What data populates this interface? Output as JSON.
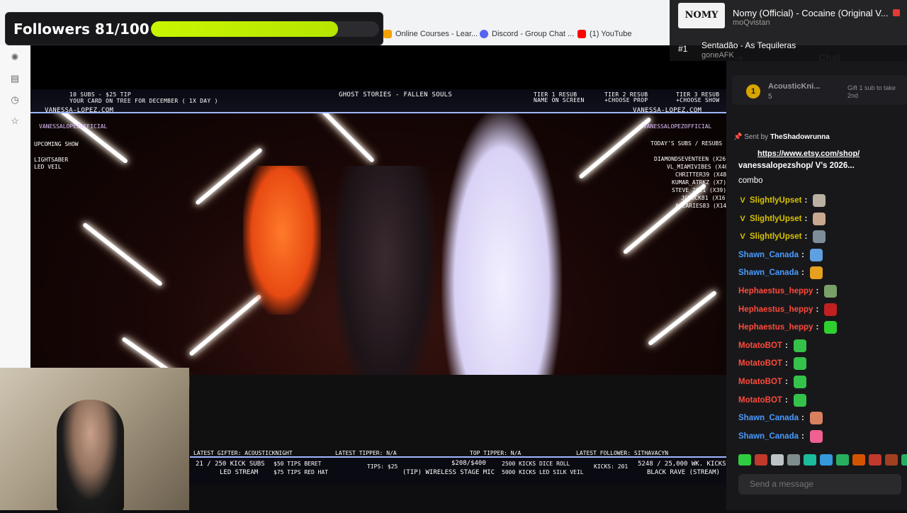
{
  "browser": {
    "bookmarks": [
      {
        "label": "Online Courses - Lear...",
        "icon": "courses-icon",
        "color": "#f2a100"
      },
      {
        "label": "Discord - Group Chat ...",
        "icon": "discord-icon",
        "color": "#5865f2"
      },
      {
        "label": "(1) YouTube",
        "icon": "youtube-icon",
        "color": "#ff0000"
      }
    ]
  },
  "followers_widget": {
    "label": "Followers 81/100",
    "progress": 0.82,
    "bar_color": "#c8f500"
  },
  "now_playing": {
    "art_text": "NOMY",
    "title": "Nomy (Official) - Cocaine (Original V...",
    "artist": "moQvistan",
    "next_rank": "#1",
    "next_title": "Sentadão - As Tequileras",
    "next_artist": "goneAFK"
  },
  "stream_overlay": {
    "top_left_1": "10 SUBS - $25 TIP",
    "top_left_2": "YOUR CARD ON TREE FOR DECEMBER ( 1X DAY )",
    "site_left": "VANESSA-LOPEZ.COM",
    "handle_left": "VANESSALOPEZOFFICIAL",
    "title_center": "GHOST STORIES - FALLEN SOULS",
    "tier1": "TIER 1 RESUB",
    "tier1_sub": "NAME ON SCREEN",
    "tier2": "TIER 2 RESUB",
    "tier2_sub": "+CHOOSE PROP",
    "tier3": "TIER 3 RESUB",
    "tier3_sub": "+CHOOSE SHOW",
    "site_right": "VANESSA-LOPEZ.COM",
    "handle_right": "VANESSALOPEZOFFICIAL",
    "upcoming": "UPCOMING SHOW",
    "upcoming_items": [
      "LIGHTSABER",
      "LED VEIL"
    ],
    "todays": "TODAY'S SUBS / RESUBS",
    "sub_list": [
      "DIAMONDSEVENTEEN (X26)",
      "VL_MIAMIVIBES (X40)",
      "CHRITTER39 (X48)",
      "KUMAR_ATRKZ (X7)",
      "STEVE_2021 (X39)",
      "JCROCK81 (X16)",
      "ACEARIES83 (X14)"
    ],
    "latest_gifter": "LATEST GIFTER: ACOUSTICKNIGHT",
    "latest_tipper": "LATEST TIPPER: N/A",
    "top_tipper": "TOP TIPPER: N/A",
    "latest_follower": "LATEST FOLLOWER: SITHAVACYN",
    "kick_subs": "21 / 250 KICK SUBS",
    "led_stream": "LED STREAM",
    "tips1": "$50  TIPS  BERET",
    "tips2": "$75  TIPS  RED HAT",
    "tips_total": "TIPS: $25",
    "goal": "$208/$400",
    "goal_item": "(TIP) WIRELESS STAGE MIC",
    "kicks1": "2500  KICKS  DICE ROLL",
    "kicks2": "5000  KICKS  LED SILK VEIL",
    "kicks_total": "KICKS: 201",
    "wk_kicks": "5248 / 25,000 WK. KICKS",
    "black_rave": "BLACK RAVE (STREAM)"
  },
  "chat": {
    "title": "Chat",
    "hype_rank": "1",
    "hype_name": "AcousticKni...",
    "hype_count": "5",
    "gift_text": "Gift 1 sub to take 2nd",
    "pinned_sender_prefix": "Sent by",
    "pinned_sender": "TheShadowrunna",
    "pinned_link": "https://www.etsy.com/shop/",
    "pinned_rest": "vanessalopezshop/ V's 2026...",
    "combo": "combo",
    "messages": [
      {
        "user": "SlightlyUpset",
        "color": "#d6c200",
        "badge": true,
        "emote": "#b9b0a2"
      },
      {
        "user": "SlightlyUpset",
        "color": "#d6c200",
        "badge": true,
        "emote": "#c9a890"
      },
      {
        "user": "SlightlyUpset",
        "color": "#d6c200",
        "badge": true,
        "emote": "#7e8d9a"
      },
      {
        "user": "Shawn_Canada",
        "color": "#4a9bff",
        "badge": false,
        "emote": "#5fa0e0"
      },
      {
        "user": "Shawn_Canada",
        "color": "#4a9bff",
        "badge": false,
        "emote": "#e6a020"
      },
      {
        "user": "Hephaestus_heppy",
        "color": "#ff4a3a",
        "badge": false,
        "emote": "#7aa06a"
      },
      {
        "user": "Hephaestus_heppy",
        "color": "#ff4a3a",
        "badge": false,
        "emote": "#c02020"
      },
      {
        "user": "Hephaestus_heppy",
        "color": "#ff4a3a",
        "badge": false,
        "emote": "#2ed02e"
      },
      {
        "user": "MotatoBOT",
        "color": "#ff4a3a",
        "badge": false,
        "emote": "#35c24a"
      },
      {
        "user": "MotatoBOT",
        "color": "#ff4a3a",
        "badge": false,
        "emote": "#35c24a"
      },
      {
        "user": "MotatoBOT",
        "color": "#ff4a3a",
        "badge": false,
        "emote": "#35c24a"
      },
      {
        "user": "MotatoBOT",
        "color": "#ff4a3a",
        "badge": false,
        "emote": "#35c24a"
      },
      {
        "user": "Shawn_Canada",
        "color": "#4a9bff",
        "badge": false,
        "emote": "#d88060"
      },
      {
        "user": "Shawn_Canada",
        "color": "#4a9bff",
        "badge": false,
        "emote": "#f06090"
      }
    ],
    "emote_bar": [
      "#2ecc40",
      "#c0392b",
      "#bdc3c7",
      "#7f8c8d",
      "#1abc9c",
      "#3498db",
      "#27ae60",
      "#d35400",
      "#c0392b",
      "#a04020",
      "#27ae60"
    ],
    "input_placeholder": "Send a message"
  }
}
